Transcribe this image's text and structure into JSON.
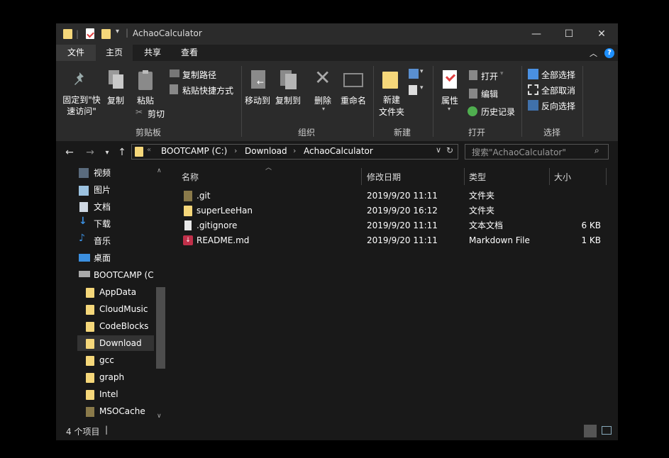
{
  "window": {
    "title": "AchaoCalculator",
    "controls": {
      "minimize": "—",
      "maximize": "☐",
      "close": "✕"
    }
  },
  "tabs": [
    "文件",
    "主页",
    "共享",
    "查看"
  ],
  "ribbon": {
    "clipboard": {
      "pin": "固定到\"快\n速访问\"",
      "copy": "复制",
      "paste": "粘贴",
      "copy_path": "复制路径",
      "paste_shortcut": "粘贴快捷方式",
      "cut": "剪切",
      "group": "剪贴板"
    },
    "organize": {
      "move_to": "移动到",
      "copy_to": "复制到",
      "delete": "删除",
      "rename": "重命名",
      "group": "组织"
    },
    "new": {
      "new_folder": "新建\n文件夹",
      "group": "新建"
    },
    "open": {
      "properties": "属性",
      "open": "打开",
      "edit": "编辑",
      "history": "历史记录",
      "group": "打开"
    },
    "select": {
      "select_all": "全部选择",
      "select_none": "全部取消",
      "invert": "反向选择",
      "group": "选择"
    }
  },
  "address": {
    "crumbs": [
      "BOOTCAMP (C:)",
      "Download",
      "AchaoCalculator"
    ],
    "search_placeholder": "搜索\"AchaoCalculator\""
  },
  "sidebar": {
    "items": [
      {
        "label": "视频",
        "icon": "video-icon"
      },
      {
        "label": "图片",
        "icon": "pictures-icon"
      },
      {
        "label": "文档",
        "icon": "documents-icon"
      },
      {
        "label": "下载",
        "icon": "download-icon"
      },
      {
        "label": "音乐",
        "icon": "music-icon"
      },
      {
        "label": "桌面",
        "icon": "desktop-icon"
      },
      {
        "label": "BOOTCAMP (C",
        "icon": "drive-icon"
      },
      {
        "label": "AppData",
        "icon": "folder-icon"
      },
      {
        "label": "CloudMusic",
        "icon": "folder-icon"
      },
      {
        "label": "CodeBlocks",
        "icon": "folder-icon"
      },
      {
        "label": "Download",
        "icon": "folder-icon"
      },
      {
        "label": "gcc",
        "icon": "folder-icon"
      },
      {
        "label": "graph",
        "icon": "folder-icon"
      },
      {
        "label": "Intel",
        "icon": "folder-icon"
      },
      {
        "label": "MSOCache",
        "icon": "folder-icon"
      }
    ],
    "selected": "Download"
  },
  "columns": [
    "名称",
    "修改日期",
    "类型",
    "大小"
  ],
  "files": [
    {
      "name": ".git",
      "date": "2019/9/20 11:11",
      "type": "文件夹",
      "size": "",
      "icon": "folder-icon"
    },
    {
      "name": "superLeeHan",
      "date": "2019/9/20 16:12",
      "type": "文件夹",
      "size": "",
      "icon": "folder-icon"
    },
    {
      "name": ".gitignore",
      "date": "2019/9/20 11:11",
      "type": "文本文档",
      "size": "6 KB",
      "icon": "text-file-icon"
    },
    {
      "name": "README.md",
      "date": "2019/9/20 11:11",
      "type": "Markdown File",
      "size": "1 KB",
      "icon": "markdown-file-icon"
    }
  ],
  "status": {
    "count": "4 个项目"
  },
  "colors": {
    "background": "#191919",
    "ribbon": "#2b2b2b",
    "accent_blue": "#1e90ff",
    "folder": "#f5d77a",
    "selected": "#333333"
  }
}
